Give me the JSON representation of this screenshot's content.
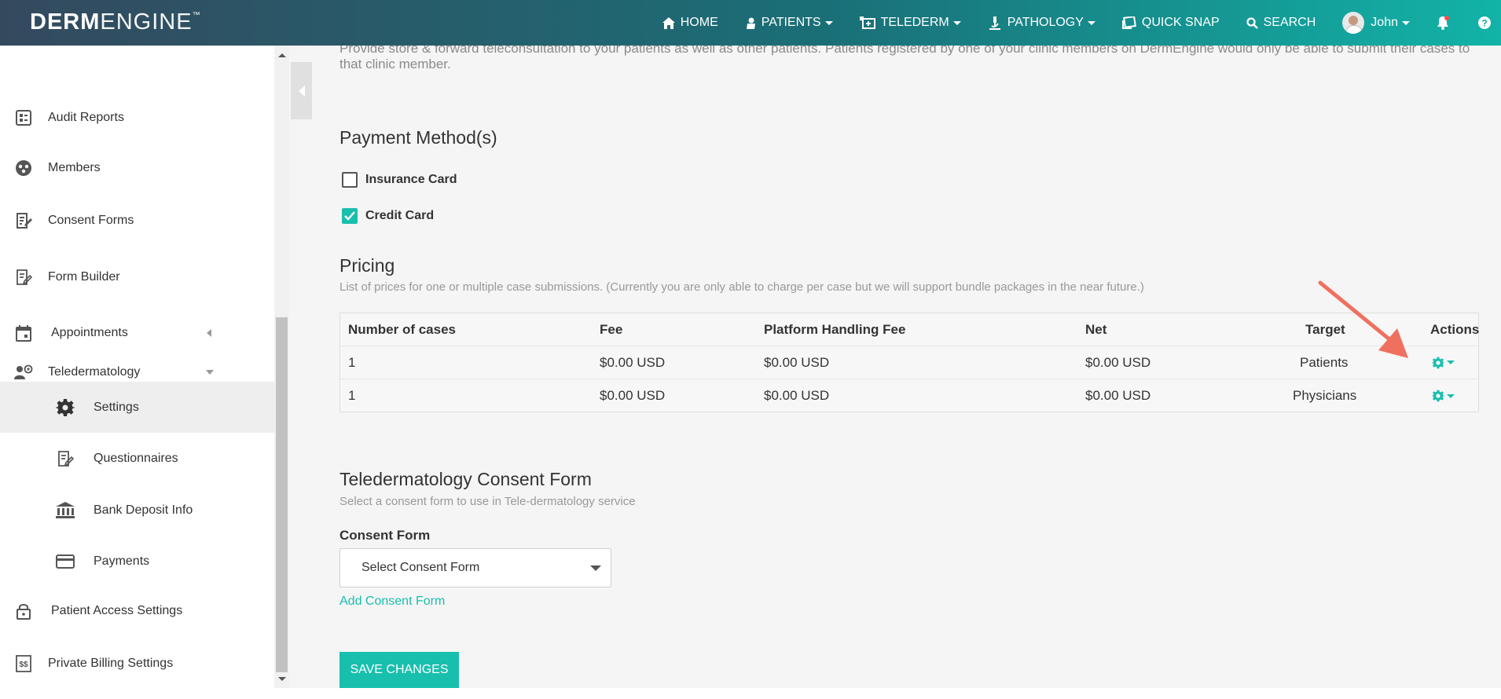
{
  "colors": {
    "accent": "#19bfad",
    "topbar_start": "#34495e",
    "topbar_end": "#12b3a8",
    "arrow": "#f07060"
  },
  "header": {
    "logo_bold": "DERM",
    "logo_thin": "ENGINE",
    "logo_tm": "™",
    "nav": {
      "home": "HOME",
      "patients": "PATIENTS",
      "telederm": "TELEDERM",
      "pathology": "PATHOLOGY",
      "quick_snap": "QUICK SNAP",
      "search": "SEARCH",
      "user": "John"
    }
  },
  "sidebar": {
    "audit_reports": "Audit Reports",
    "members": "Members",
    "consent_forms": "Consent Forms",
    "form_builder": "Form Builder",
    "appointments": "Appointments",
    "teledermatology": "Teledermatology",
    "settings": "Settings",
    "questionnaires": "Questionnaires",
    "bank_deposit_info": "Bank Deposit Info",
    "payments": "Payments",
    "patient_access_settings": "Patient Access Settings",
    "private_billing_settings": "Private Billing Settings"
  },
  "main": {
    "intro": "Provide store & forward teleconsultation to your patients as well as other patients. Patients registered by one of your clinic members on DermEngine would only be able to submit their cases to that clinic member.",
    "payment_title": "Payment Method(s)",
    "insurance_card": "Insurance Card",
    "insurance_checked": false,
    "credit_card": "Credit Card",
    "credit_checked": true,
    "pricing_title": "Pricing",
    "pricing_desc": "List of prices for one or multiple case submissions. (Currently you are only able to charge per case but we will support bundle packages in the near future.)",
    "table": {
      "headers": {
        "cases": "Number of cases",
        "fee": "Fee",
        "platform_fee": "Platform Handling Fee",
        "net": "Net",
        "target": "Target",
        "actions": "Actions"
      },
      "rows": [
        {
          "cases": "1",
          "fee": "$0.00 USD",
          "platform_fee": "$0.00 USD",
          "net": "$0.00 USD",
          "target": "Patients"
        },
        {
          "cases": "1",
          "fee": "$0.00 USD",
          "platform_fee": "$0.00 USD",
          "net": "$0.00 USD",
          "target": "Physicians"
        }
      ]
    },
    "consent_title": "Teledermatology Consent Form",
    "consent_desc": "Select a consent form to use in Tele-dermatology service",
    "consent_label": "Consent Form",
    "consent_select": "Select Consent Form",
    "add_consent": "Add Consent Form",
    "save": "SAVE CHANGES"
  }
}
